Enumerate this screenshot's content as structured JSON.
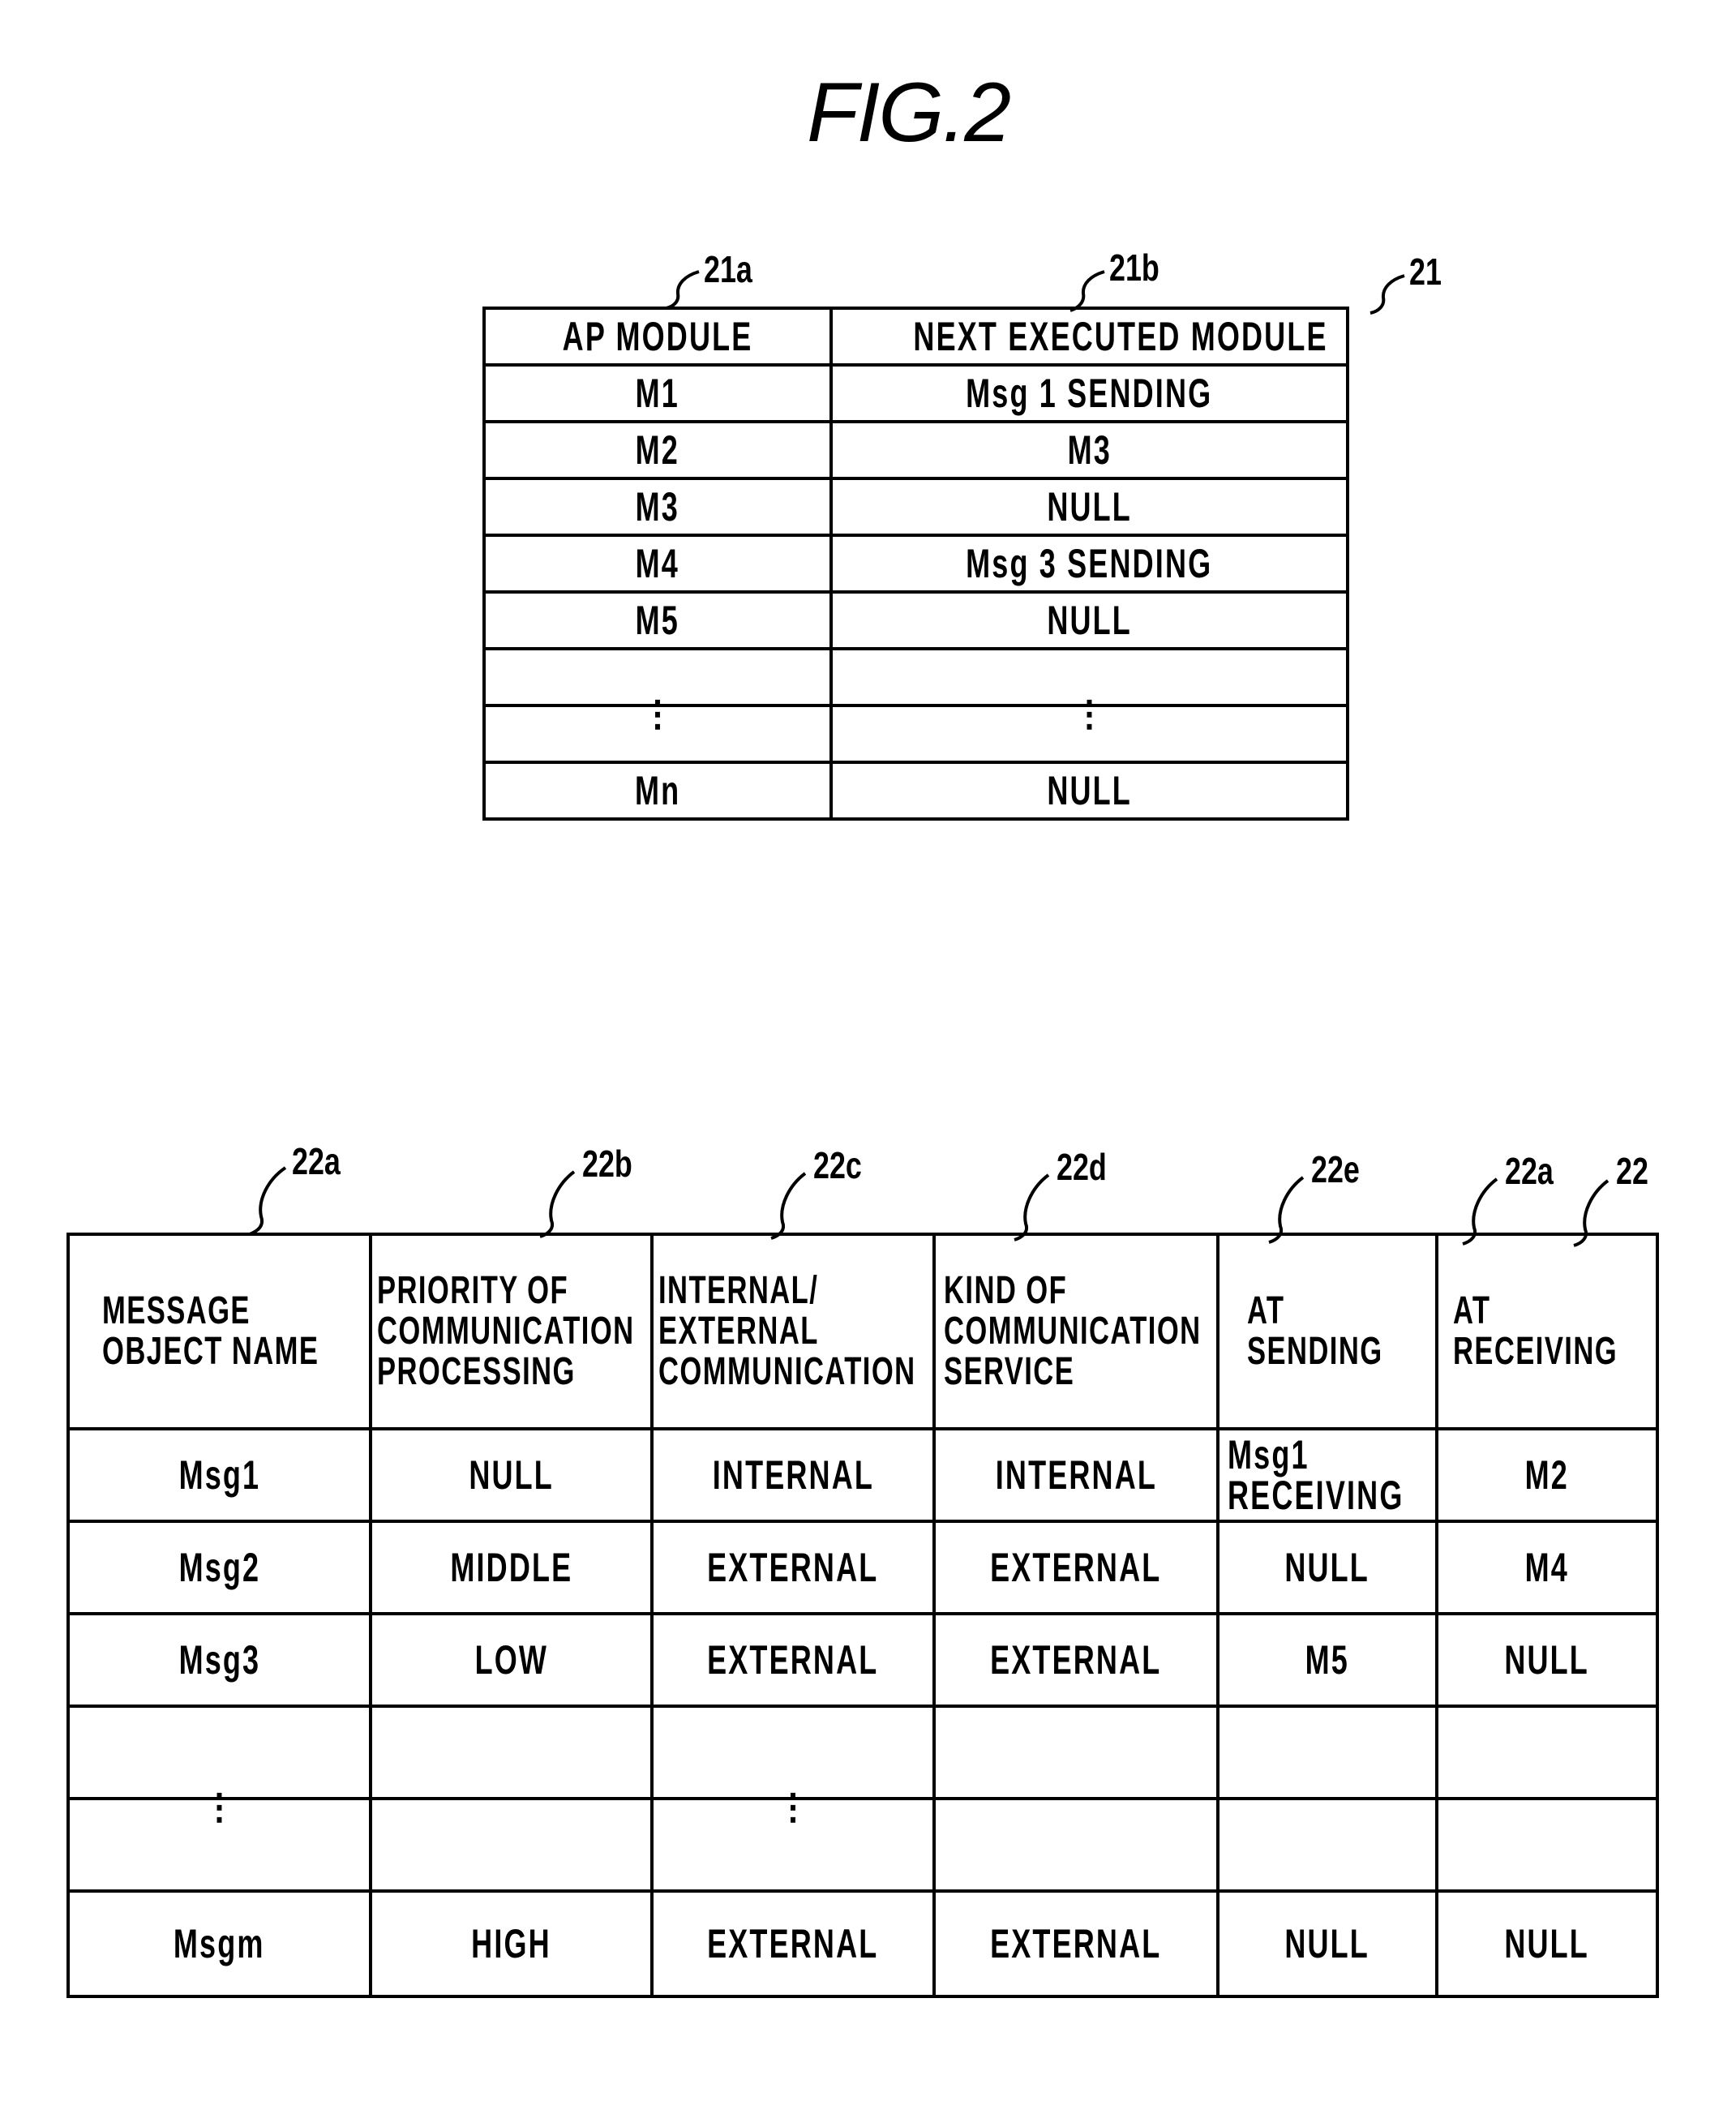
{
  "figure": {
    "title": "FIG.2"
  },
  "table21": {
    "ref": "21",
    "column_refs": [
      "21a",
      "21b"
    ],
    "headers": [
      "AP MODULE",
      "NEXT EXECUTED MODULE"
    ],
    "rows": [
      [
        "M1",
        "Msg 1 SENDING"
      ],
      [
        "M2",
        "M3"
      ],
      [
        "M3",
        "NULL"
      ],
      [
        "M4",
        "Msg 3 SENDING"
      ],
      [
        "M5",
        "NULL"
      ],
      [
        "",
        ""
      ],
      [
        "⋮",
        "⋮"
      ],
      [
        "Mn",
        "NULL"
      ]
    ]
  },
  "table22": {
    "ref": "22",
    "column_refs": [
      "22a",
      "22b",
      "22c",
      "22d",
      "22e",
      "22a"
    ],
    "headers": [
      "MESSAGE\nOBJECT NAME",
      "PRIORITY OF\nCOMMUNICATION\nPROCESSING",
      "INTERNAL/\nEXTERNAL\nCOMMUNICATION",
      "KIND OF\nCOMMUNICATION\nSERVICE",
      "AT\nSENDING",
      "AT\nRECEIVING"
    ],
    "rows": [
      [
        "Msg1",
        "NULL",
        "INTERNAL",
        "INTERNAL",
        "Msg1\nRECEIVING",
        "M2"
      ],
      [
        "Msg2",
        "MIDDLE",
        "EXTERNAL",
        "EXTERNAL",
        "NULL",
        "M4"
      ],
      [
        "Msg3",
        "LOW",
        "EXTERNAL",
        "EXTERNAL",
        "M5",
        "NULL"
      ],
      [
        "",
        "",
        "",
        "",
        "",
        ""
      ],
      [
        "⋮",
        "",
        "⋮",
        "",
        "",
        ""
      ],
      [
        "Msgm",
        "HIGH",
        "EXTERNAL",
        "EXTERNAL",
        "NULL",
        "NULL"
      ]
    ]
  }
}
